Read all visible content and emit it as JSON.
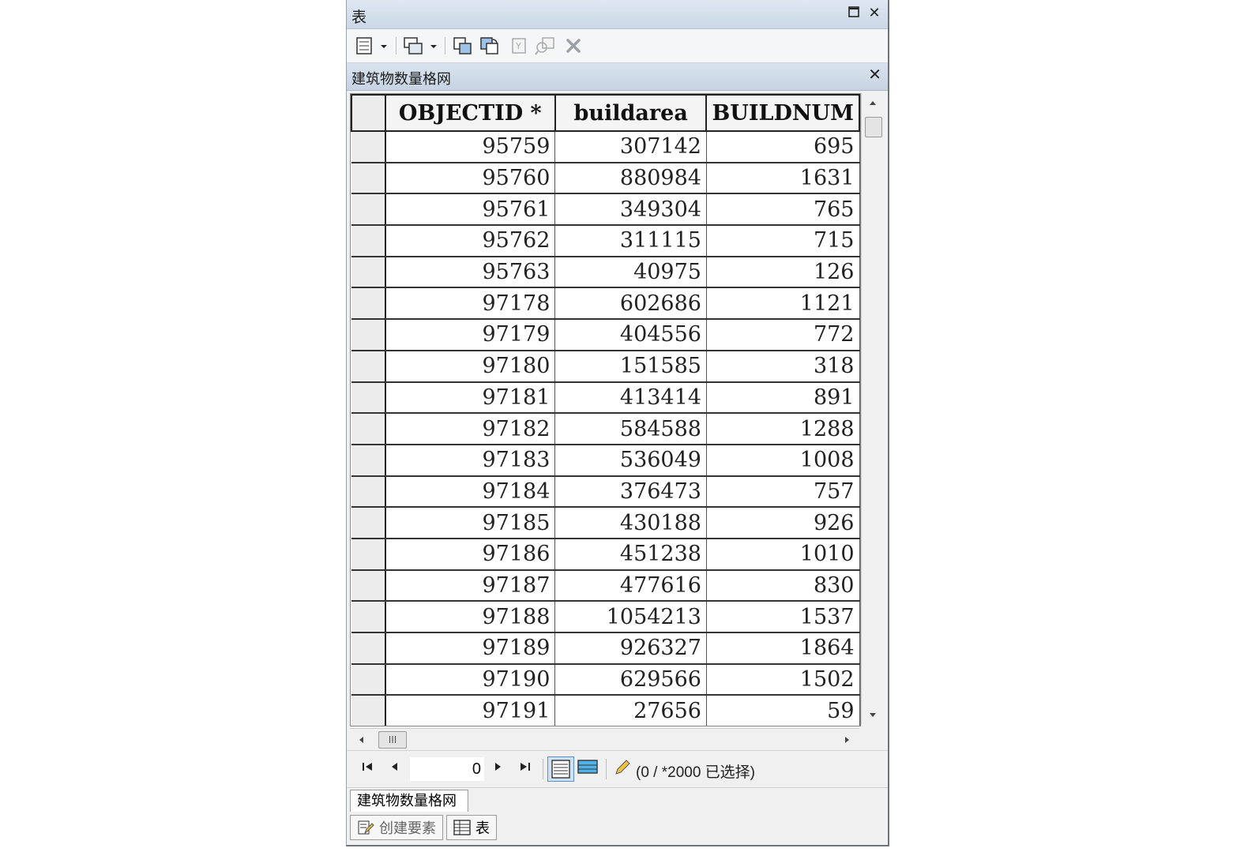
{
  "window": {
    "title": "表"
  },
  "panel": {
    "title": "建筑物数量格网"
  },
  "table": {
    "columns": [
      "OBJECTID *",
      "buildarea",
      "BUILDNUM"
    ],
    "rows": [
      [
        "95759",
        "307142",
        "695"
      ],
      [
        "95760",
        "880984",
        "1631"
      ],
      [
        "95761",
        "349304",
        "765"
      ],
      [
        "95762",
        "311115",
        "715"
      ],
      [
        "95763",
        "40975",
        "126"
      ],
      [
        "97178",
        "602686",
        "1121"
      ],
      [
        "97179",
        "404556",
        "772"
      ],
      [
        "97180",
        "151585",
        "318"
      ],
      [
        "97181",
        "413414",
        "891"
      ],
      [
        "97182",
        "584588",
        "1288"
      ],
      [
        "97183",
        "536049",
        "1008"
      ],
      [
        "97184",
        "376473",
        "757"
      ],
      [
        "97185",
        "430188",
        "926"
      ],
      [
        "97186",
        "451238",
        "1010"
      ],
      [
        "97187",
        "477616",
        "830"
      ],
      [
        "97188",
        "1054213",
        "1537"
      ],
      [
        "97189",
        "926327",
        "1864"
      ],
      [
        "97190",
        "629566",
        "1502"
      ],
      [
        "97191",
        "27656",
        "59"
      ]
    ]
  },
  "navigation": {
    "current_record": "0",
    "selection_info": "(0 / *2000 已选择)"
  },
  "layer_tab": {
    "label": "建筑物数量格网"
  },
  "bottom_tabs": [
    {
      "label": "创建要素"
    },
    {
      "label": "表"
    }
  ],
  "hscroll": {
    "thumb_label": "III"
  },
  "icons": {
    "table-options": "table-options-icon",
    "related-tables": "related-tables-icon",
    "select-by-attributes": "select-by-attributes-icon",
    "switch-selection": "switch-selection-icon",
    "clear-selection": "clear-selection-icon",
    "zoom-to-selected": "zoom-to-selected-icon",
    "delete-selected": "delete-icon"
  }
}
